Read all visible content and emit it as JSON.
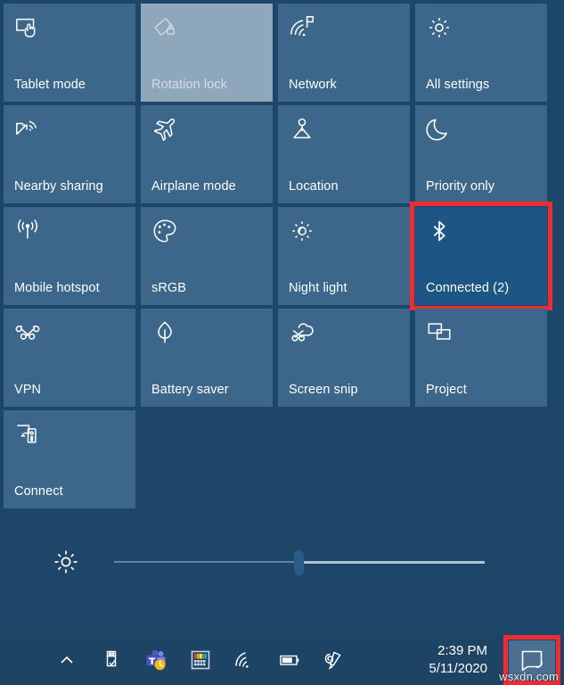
{
  "window": {
    "name": "Windows 10 Action Center",
    "background_color": "#1e4668",
    "tile_color": "#3c678b",
    "tile_active_color": "#1d5584",
    "tile_disabled_color": "#8fa7bb",
    "highlight_color": "#ef2c34"
  },
  "tiles": [
    {
      "label": "Tablet mode",
      "icon": "tablet-mode-icon",
      "state": "normal"
    },
    {
      "label": "Rotation lock",
      "icon": "rotation-lock-icon",
      "state": "disabled"
    },
    {
      "label": "Network",
      "icon": "network-icon",
      "state": "normal"
    },
    {
      "label": "All settings",
      "icon": "settings-gear-icon",
      "state": "normal"
    },
    {
      "label": "Nearby sharing",
      "icon": "nearby-sharing-icon",
      "state": "normal"
    },
    {
      "label": "Airplane mode",
      "icon": "airplane-icon",
      "state": "normal"
    },
    {
      "label": "Location",
      "icon": "location-icon",
      "state": "normal"
    },
    {
      "label": "Priority only",
      "icon": "moon-icon",
      "state": "normal"
    },
    {
      "label": "Mobile hotspot",
      "icon": "hotspot-icon",
      "state": "normal"
    },
    {
      "label": "sRGB",
      "icon": "color-palette-icon",
      "state": "normal"
    },
    {
      "label": "Night light",
      "icon": "night-light-icon",
      "state": "normal"
    },
    {
      "label": "Connected (2)",
      "icon": "bluetooth-icon",
      "state": "active",
      "highlighted": true
    },
    {
      "label": "VPN",
      "icon": "vpn-icon",
      "state": "normal"
    },
    {
      "label": "Battery saver",
      "icon": "leaf-icon",
      "state": "normal"
    },
    {
      "label": "Screen snip",
      "icon": "screen-snip-icon",
      "state": "normal"
    },
    {
      "label": "Project",
      "icon": "project-icon",
      "state": "normal"
    },
    {
      "label": "Connect",
      "icon": "connect-icon",
      "state": "normal"
    }
  ],
  "brightness": {
    "icon": "brightness-icon",
    "value": 50,
    "min": 0,
    "max": 100
  },
  "taskbar": {
    "tray_icons": [
      {
        "name": "show-hidden-icons-chevron-icon"
      },
      {
        "name": "safely-remove-usb-icon"
      },
      {
        "name": "microsoft-teams-icon"
      },
      {
        "name": "color-keyboard-icon"
      },
      {
        "name": "wifi-icon"
      },
      {
        "name": "battery-icon"
      },
      {
        "name": "pen-menu-icon"
      }
    ],
    "clock": {
      "time": "2:39 PM",
      "date": "5/11/2020"
    },
    "action_center_button": {
      "icon": "action-center-icon",
      "highlighted": true
    }
  },
  "watermark": "wsxdn.com"
}
